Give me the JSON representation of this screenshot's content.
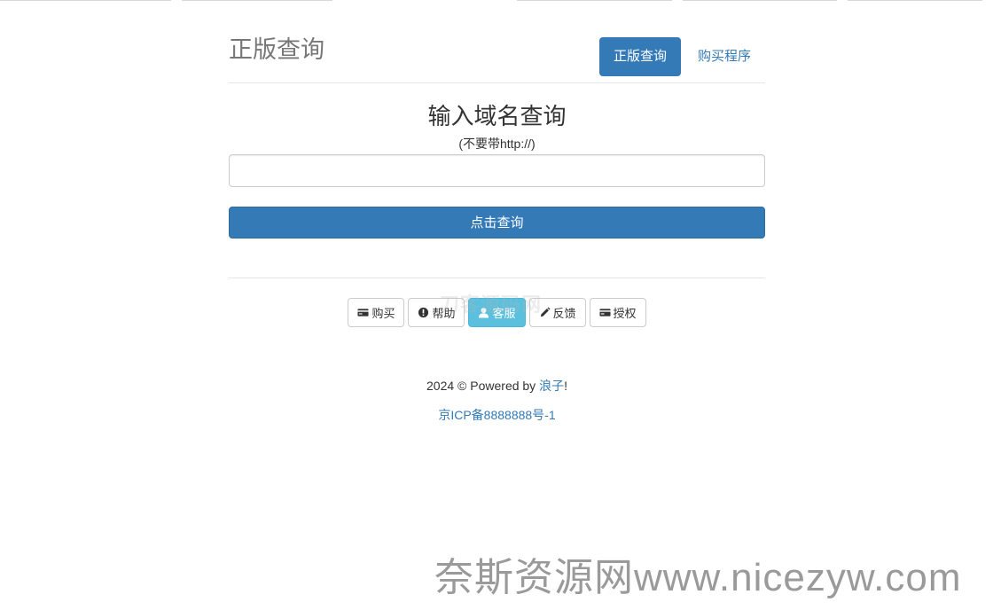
{
  "brand": "正版查询",
  "nav": {
    "active_label": "正版查询",
    "buy_label": "购买程序"
  },
  "query": {
    "heading": "输入域名查询",
    "hint": "(不要带http://)",
    "input_value": "",
    "submit_label": "点击查询"
  },
  "buttons": [
    {
      "label": "购买",
      "icon": "credit-card-icon"
    },
    {
      "label": "帮助",
      "icon": "exclamation-circle-icon"
    },
    {
      "label": "客服",
      "icon": "user-icon"
    },
    {
      "label": "反馈",
      "icon": "pencil-icon"
    },
    {
      "label": "授权",
      "icon": "credit-card-icon"
    }
  ],
  "faint_mark": "刀客源码网",
  "footer": {
    "powered_prefix": "2024 © Powered by ",
    "author": "浪子",
    "powered_suffix": "!",
    "icp": "京ICP备8888888号-1"
  },
  "watermark": "奈斯资源网www.nicezyw.com",
  "colors": {
    "primary": "#337ab7",
    "info": "#5bc0de",
    "border": "#cccccc",
    "brand_text": "#777777"
  }
}
